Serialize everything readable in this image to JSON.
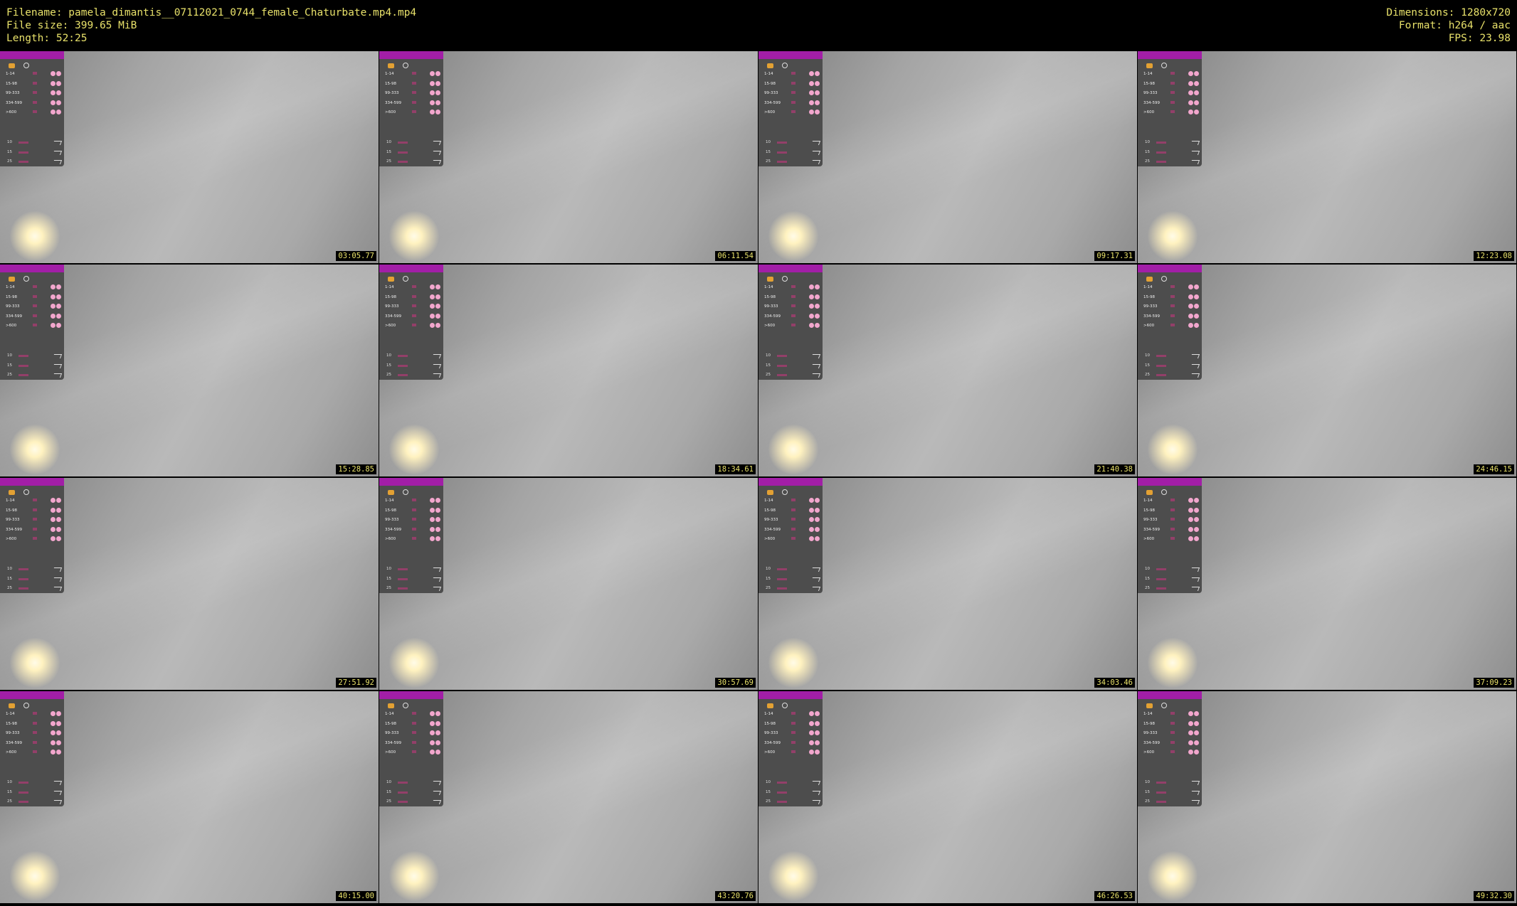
{
  "header": {
    "left": [
      "Filename: pamela_dimantis__07112021_0744_female_Chaturbate.mp4.mp4",
      "File size: 399.65 MiB",
      "Length: 52:25"
    ],
    "right": [
      "Dimensions: 1280x720",
      "Format: h264 / aac",
      "FPS: 23.98"
    ]
  },
  "panel": {
    "rows": [
      "1-14",
      "15-98",
      "99-333",
      "334-599",
      ">600"
    ],
    "modes": [
      "10",
      "15",
      "25"
    ]
  },
  "timestamps": [
    "03:05.77",
    "06:11.54",
    "09:17.31",
    "12:23.08",
    "15:28.85",
    "18:34.61",
    "21:40.38",
    "24:46.15",
    "27:51.92",
    "30:57.69",
    "34:03.46",
    "37:09.23",
    "40:15.00",
    "43:20.76",
    "46:26.53",
    "49:32.30"
  ]
}
